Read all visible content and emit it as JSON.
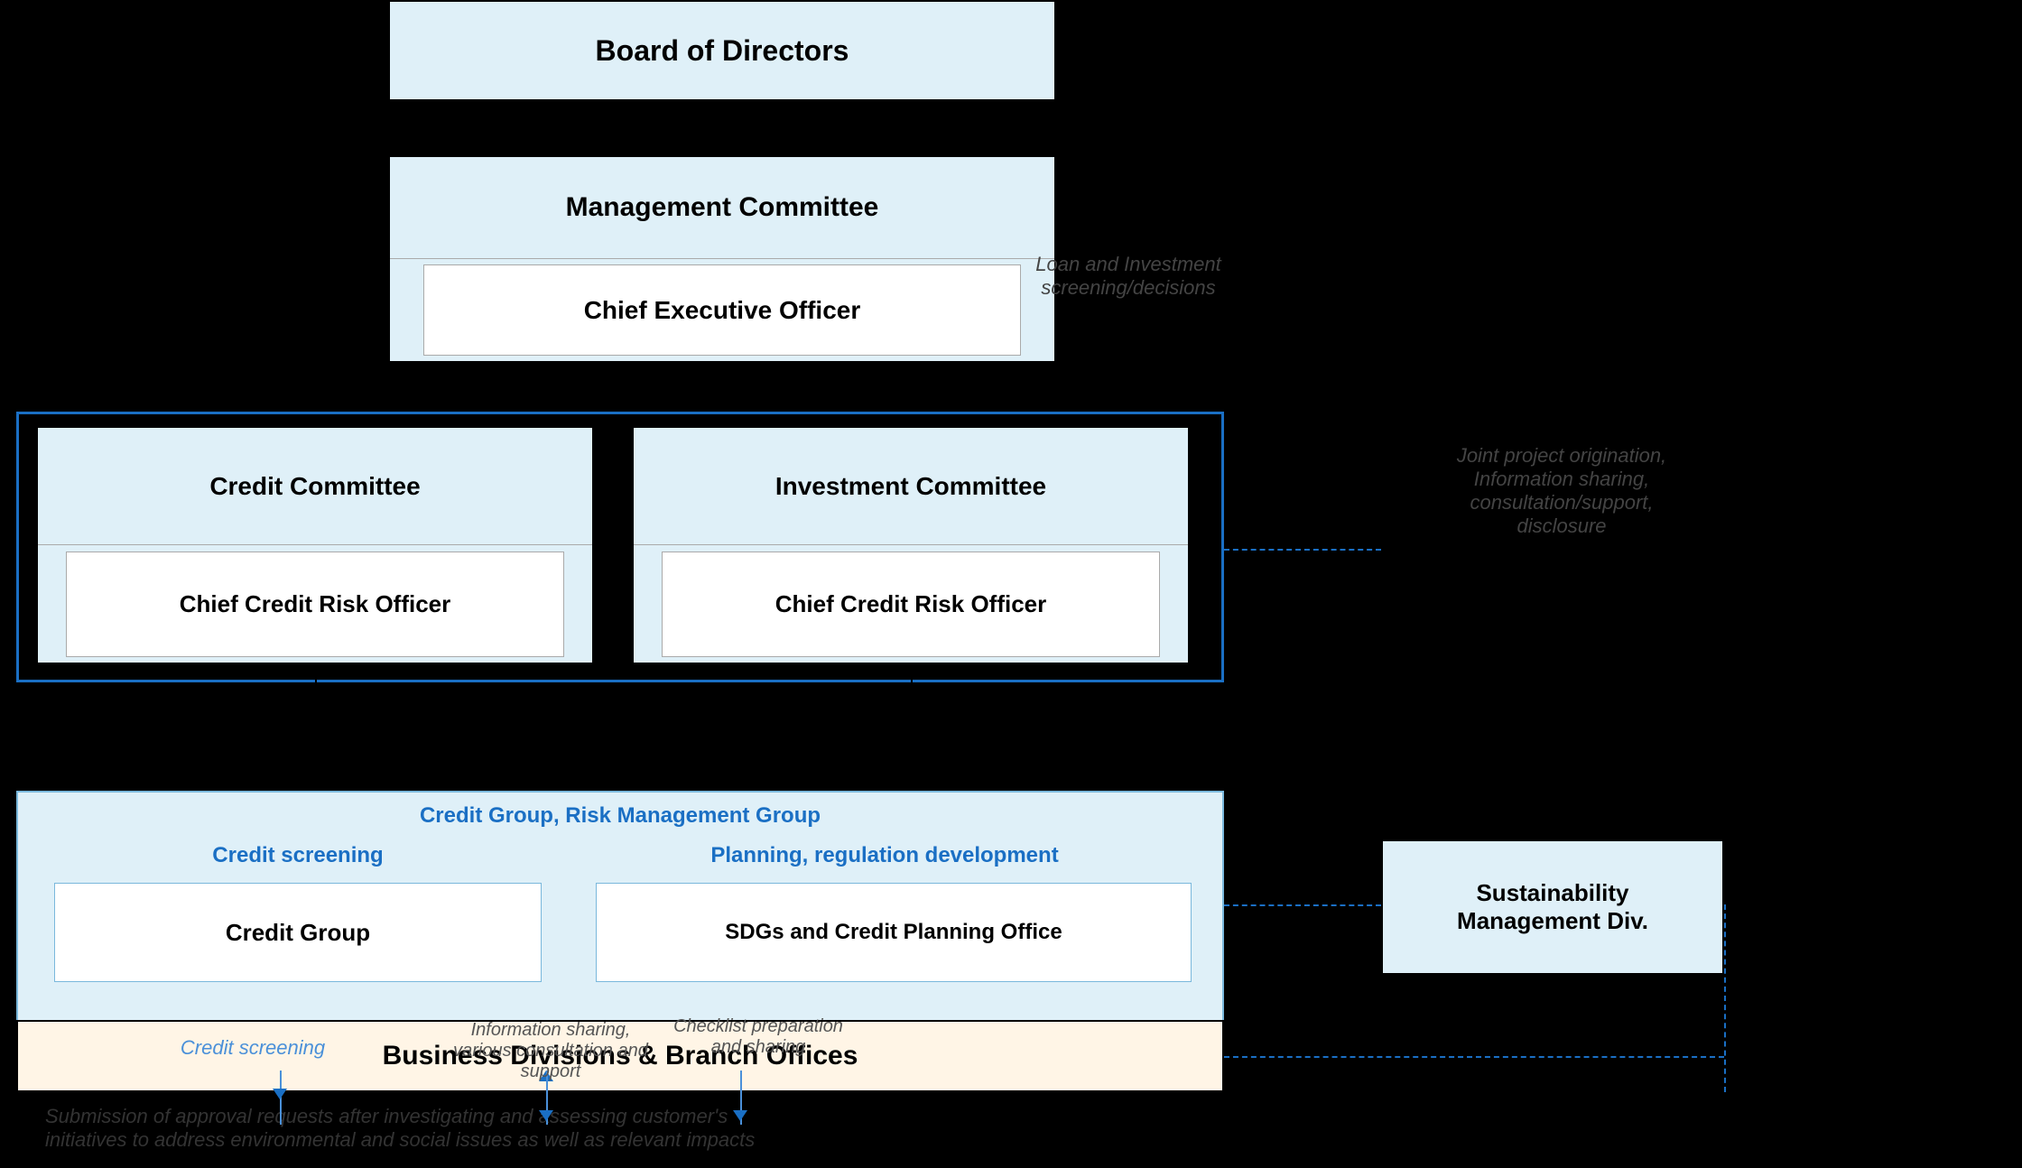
{
  "boxes": {
    "board": "Board of Directors",
    "management_committee": "Management Committee",
    "ceo": "Chief Executive Officer",
    "credit_committee": "Credit Committee",
    "cc_officer": "Chief Credit Risk Officer",
    "investment_committee": "Investment Committee",
    "ic_officer": "Chief Credit Risk Officer",
    "group_label": "Credit Group, Risk Management Group",
    "credit_screening_label": "Credit screening",
    "planning_label": "Planning, regulation development",
    "credit_group": "Credit Group",
    "sdgs": "SDGs and Credit Planning Office",
    "business_divisions": "Business Divisions & Branch Offices",
    "sustainability": "Sustainability\nManagement Div."
  },
  "labels": {
    "loan_investment": "Loan and Investment\nscreening/decisions",
    "joint_project": "Joint project origination,\nInformation sharing,\nconsultation/support,\ndisclosure",
    "credit_screening_arrow": "Credit screening",
    "info_sharing": "Information sharing,\nvarious consultation\nand support",
    "checklist": "Checklist\npreparation and\nsharing",
    "submission": "Submission of approval requests after investigating and assessing customer's\ninitiatives to address environmental and social issues as well as relevant impacts"
  }
}
